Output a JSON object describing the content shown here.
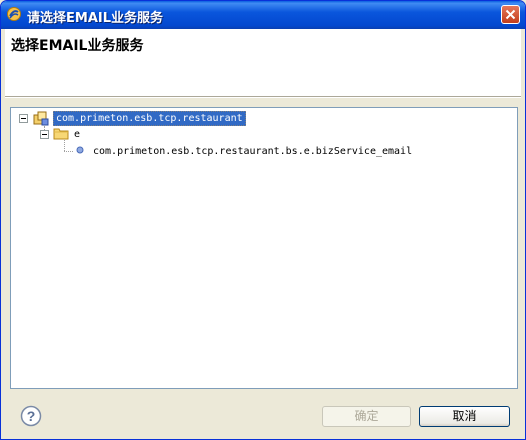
{
  "window": {
    "title": "请选择EMAIL业务服务",
    "banner_title": "选择EMAIL业务服务"
  },
  "tree": {
    "root": {
      "label": "com.primeton.esb.tcp.restaurant",
      "selected": true,
      "expanded": true
    },
    "folder": {
      "label": "e",
      "expanded": true
    },
    "leaf": {
      "label": "com.primeton.esb.tcp.restaurant.bs.e.bizService_email"
    }
  },
  "buttons": {
    "ok": "确定",
    "cancel": "取消"
  },
  "icons": [
    "app-logo-icon",
    "close-icon",
    "package-project-icon",
    "folder-icon",
    "service-dot-icon",
    "help-icon"
  ],
  "colors": {
    "title_bar": "#0a56dc",
    "selection": "#316ac5",
    "dialog_bg": "#ece9d8"
  }
}
